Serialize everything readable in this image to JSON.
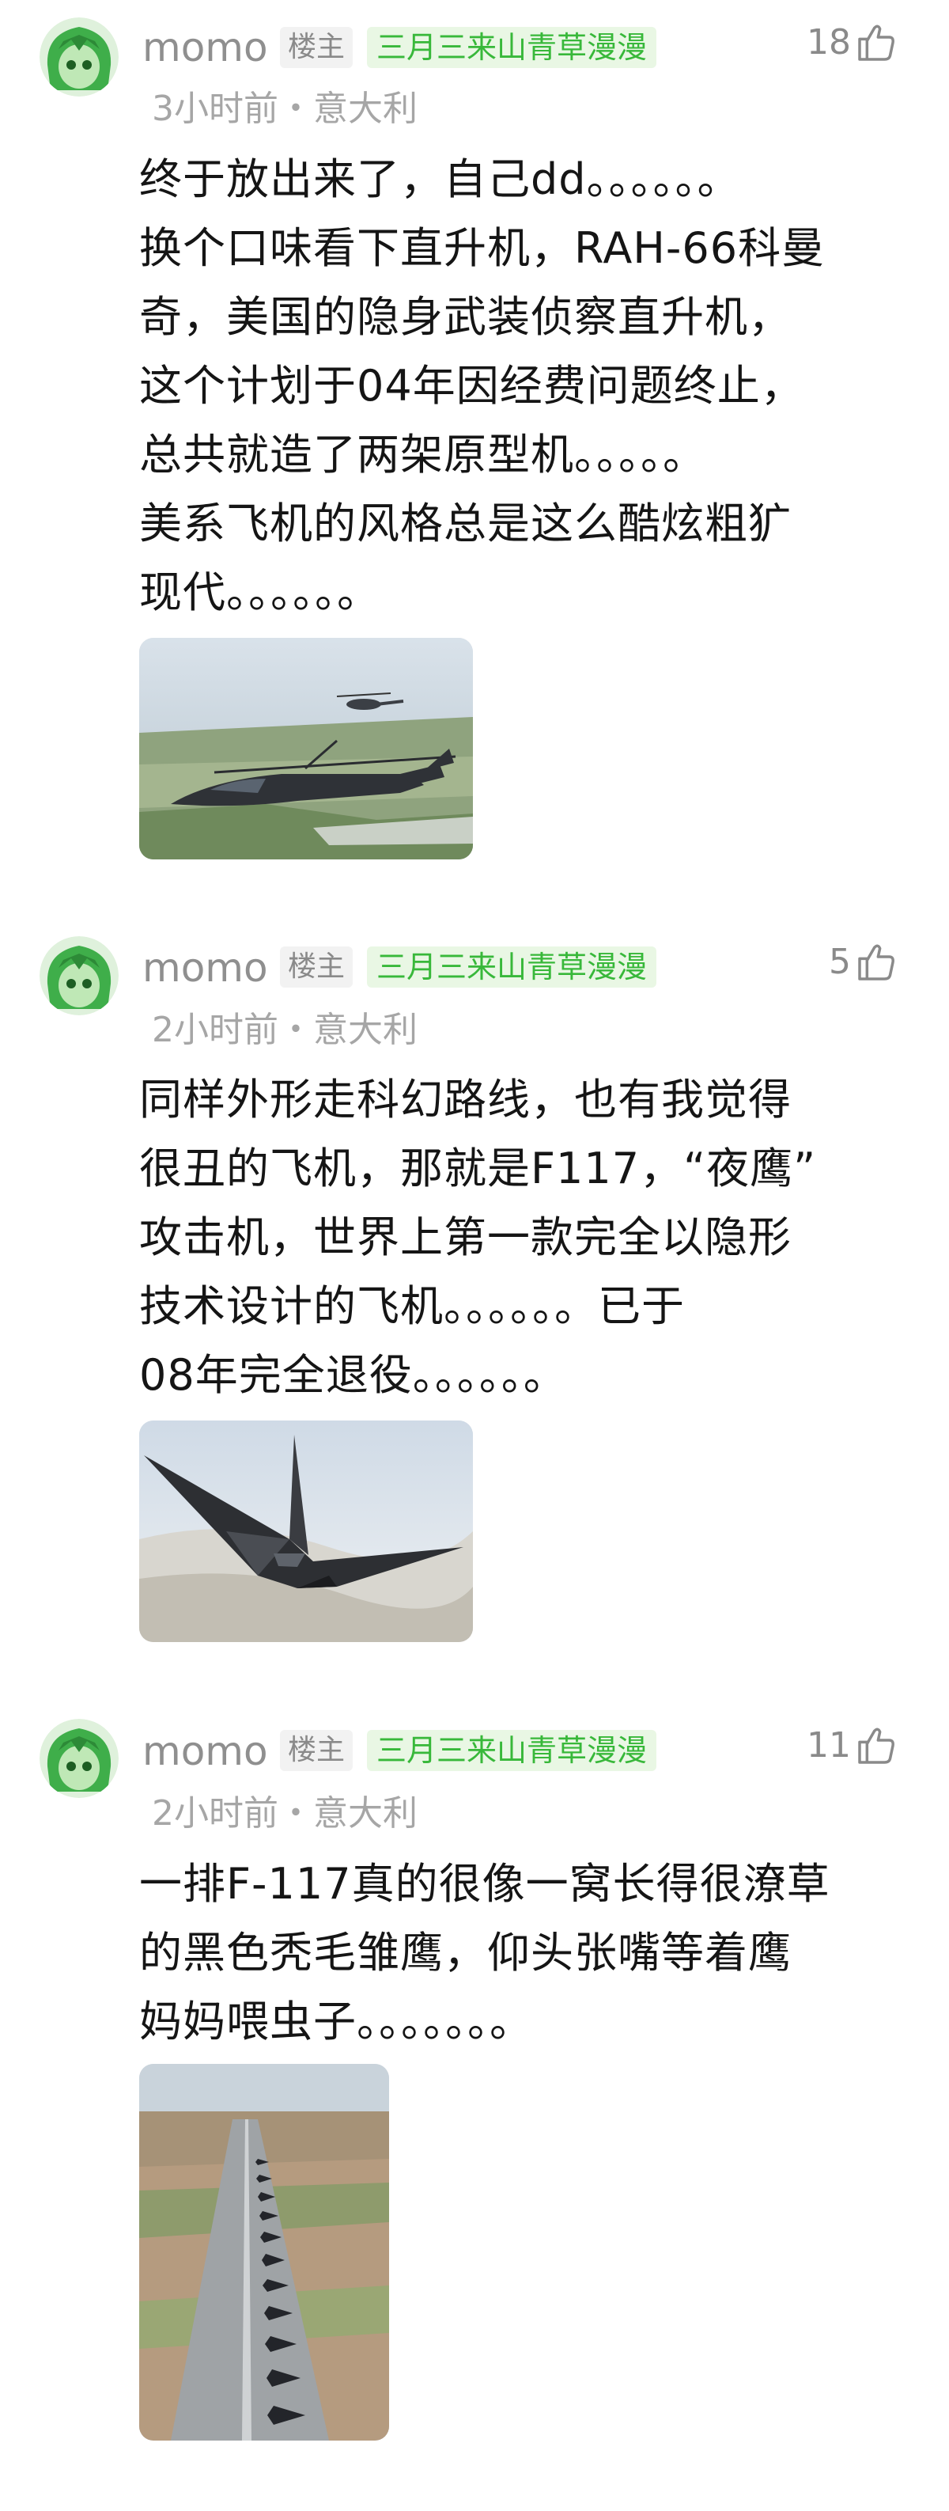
{
  "colors": {
    "username": "#8f8f8f",
    "fan_badge_text": "#38b83a",
    "fan_badge_bg": "#e9f7e4",
    "meta": "#a6a6a6"
  },
  "comments": [
    {
      "username": "momo",
      "role_badge": "楼主",
      "fan_badge": "三月三来山青草漫漫",
      "likes": "18",
      "meta": "3小时前・意大利",
      "lines": [
        "终于放出来了，自己dd。。。。。。",
        "换个口味看下直升机，RAH-66科曼",
        "奇，美国的隐身武装侦察直升机，",
        "这个计划于04年因经费问题终止，",
        "总共就造了两架原型机。。。。。",
        "美系飞机的风格总是这么酷炫粗犷",
        "现代。。。。。。"
      ],
      "image_icon": "helicopter-photo"
    },
    {
      "username": "momo",
      "role_badge": "楼主",
      "fan_badge": "三月三来山青草漫漫",
      "likes": "5",
      "meta": "2小时前・意大利",
      "lines": [
        "同样外形走科幻路线，也有我觉得",
        "很丑的飞机，那就是F117，“夜鹰”",
        "攻击机，世界上第一款完全以隐形",
        "技术设计的飞机。。。。。。已于",
        "08年完全退役。。。。。。"
      ],
      "image_icon": "stealth-jet-photo"
    },
    {
      "username": "momo",
      "role_badge": "楼主",
      "fan_badge": "三月三来山青草漫漫",
      "likes": "11",
      "meta": "2小时前・意大利",
      "lines": [
        "一排F-117真的很像一窝长得很潦草",
        "的黑色秃毛雏鹰，仰头张嘴等着鹰",
        "妈妈喂虫子。。。。。。。"
      ],
      "image_icon": "runway-lineup-photo"
    }
  ]
}
